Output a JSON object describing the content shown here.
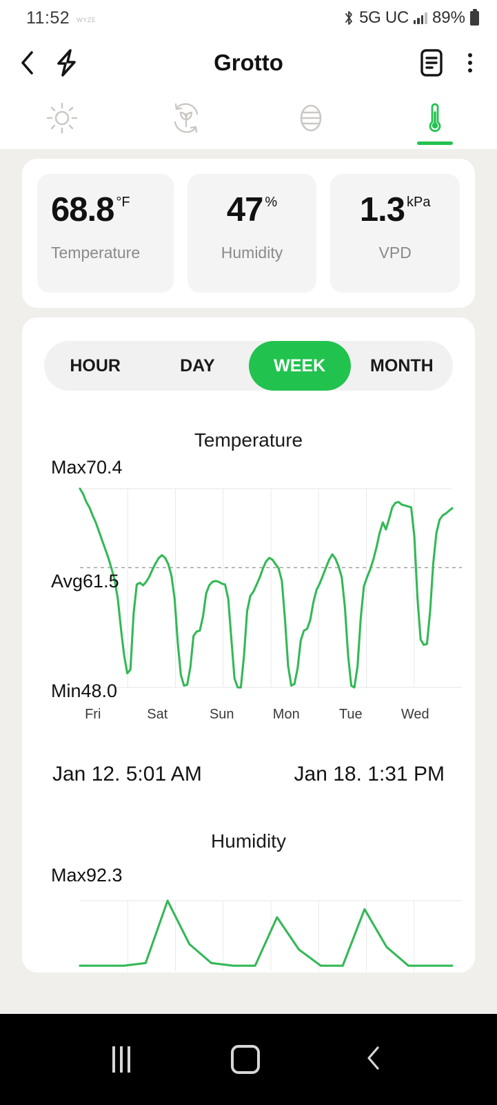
{
  "status_bar": {
    "time": "11:52",
    "app_badge": "WYZE",
    "network": "5G UC",
    "battery_percent": "89%",
    "icons": [
      "bluetooth-icon",
      "signal-bars-icon",
      "battery-icon"
    ]
  },
  "app_bar": {
    "title": "Grotto",
    "back_label": "‹",
    "bolt_label": "bolt",
    "notes_label": "notes",
    "menu_label": "more"
  },
  "tabs": [
    {
      "name": "light",
      "icon": "sun-icon",
      "active": false
    },
    {
      "name": "cycle",
      "icon": "plant-cycle-icon",
      "active": false
    },
    {
      "name": "airflow",
      "icon": "airflow-icon",
      "active": false
    },
    {
      "name": "climate",
      "icon": "thermometer-icon",
      "active": true
    }
  ],
  "metrics": [
    {
      "value": "68.8",
      "unit": "°F",
      "label": "Temperature"
    },
    {
      "value": "47",
      "unit": "%",
      "label": "Humidity"
    },
    {
      "value": "1.3",
      "unit": "kPa",
      "label": "VPD"
    }
  ],
  "range_selector": {
    "options": [
      "HOUR",
      "DAY",
      "WEEK",
      "MONTH"
    ],
    "selected": "WEEK"
  },
  "date_range": {
    "start": "Jan 12. 5:01 AM",
    "end": "Jan 18. 1:31 PM"
  },
  "colors": {
    "accent_green": "#22c24e",
    "line_green": "#34b857",
    "page_bg": "#f0efeb",
    "card_bg": "#ffffff",
    "metric_bg": "#f4f4f4",
    "muted_text": "#8a8a8a"
  },
  "nav_bar": {
    "recents_label": "recents",
    "home_label": "home",
    "back_label": "back"
  },
  "chart_data": [
    {
      "type": "line",
      "title": "Temperature",
      "xlabel": "",
      "ylabel": "°F",
      "grid": true,
      "legend": "none",
      "max_label": "Max70.4",
      "avg_label": "Avg61.5",
      "min_label": "Min48.0",
      "max": 70.4,
      "avg": 61.5,
      "min": 48.0,
      "ylim": [
        48.0,
        70.4
      ],
      "avg_reference_line": 61.5,
      "categories": [
        "Fri",
        "Sat",
        "Sun",
        "Mon",
        "Tue",
        "Wed",
        ""
      ],
      "tick_labels": [
        "Fri",
        "Sat",
        "Sun",
        "Mon",
        "Tue",
        "Wed"
      ],
      "series": [
        {
          "name": "Temperature",
          "color": "#34b857",
          "values": [
            70.4,
            69.8,
            68.9,
            68.3,
            67.4,
            66.6,
            65.6,
            64.6,
            63.6,
            62.6,
            61.4,
            60.1,
            58.0,
            54.6,
            51.6,
            49.6,
            50.0,
            56.3,
            59.6,
            59.8,
            59.5,
            59.9,
            60.5,
            61.3,
            62.0,
            62.6,
            62.9,
            62.6,
            61.9,
            60.6,
            58.0,
            53.0,
            49.4,
            48.2,
            48.3,
            50.3,
            53.8,
            54.3,
            54.4,
            56.0,
            58.6,
            59.5,
            59.9,
            60.0,
            59.9,
            59.7,
            59.6,
            58.0,
            53.4,
            49.0,
            48.0,
            48.0,
            51.6,
            56.6,
            58.3,
            58.8,
            59.6,
            60.4,
            61.4,
            62.2,
            62.6,
            62.4,
            61.9,
            61.4,
            60.0,
            55.6,
            50.4,
            48.2,
            48.4,
            50.2,
            53.3,
            54.4,
            54.6,
            55.6,
            57.6,
            59.0,
            59.7,
            60.6,
            61.5,
            62.4,
            63.0,
            62.5,
            61.6,
            60.4,
            57.0,
            51.6,
            48.2,
            48.0,
            50.4,
            55.8,
            59.4,
            60.4,
            61.3,
            62.4,
            63.8,
            65.4,
            66.6,
            65.8,
            67.0,
            68.3,
            68.8,
            68.9,
            68.6,
            68.5,
            68.4,
            68.3,
            65.0,
            58.0,
            53.4,
            52.8,
            52.9,
            56.6,
            62.0,
            65.4,
            66.9,
            67.4,
            67.6,
            67.9,
            68.2
          ]
        }
      ]
    },
    {
      "type": "line",
      "title": "Humidity",
      "xlabel": "",
      "ylabel": "%",
      "grid": true,
      "legend": "none",
      "max_label": "Max92.3",
      "max": 92.3,
      "series": [
        {
          "name": "Humidity",
          "color": "#34b857",
          "values": [
            44,
            44,
            44,
            46,
            92.3,
            60,
            46,
            44,
            44,
            80,
            56,
            44,
            44,
            86,
            58,
            44,
            44,
            44
          ]
        }
      ]
    }
  ]
}
